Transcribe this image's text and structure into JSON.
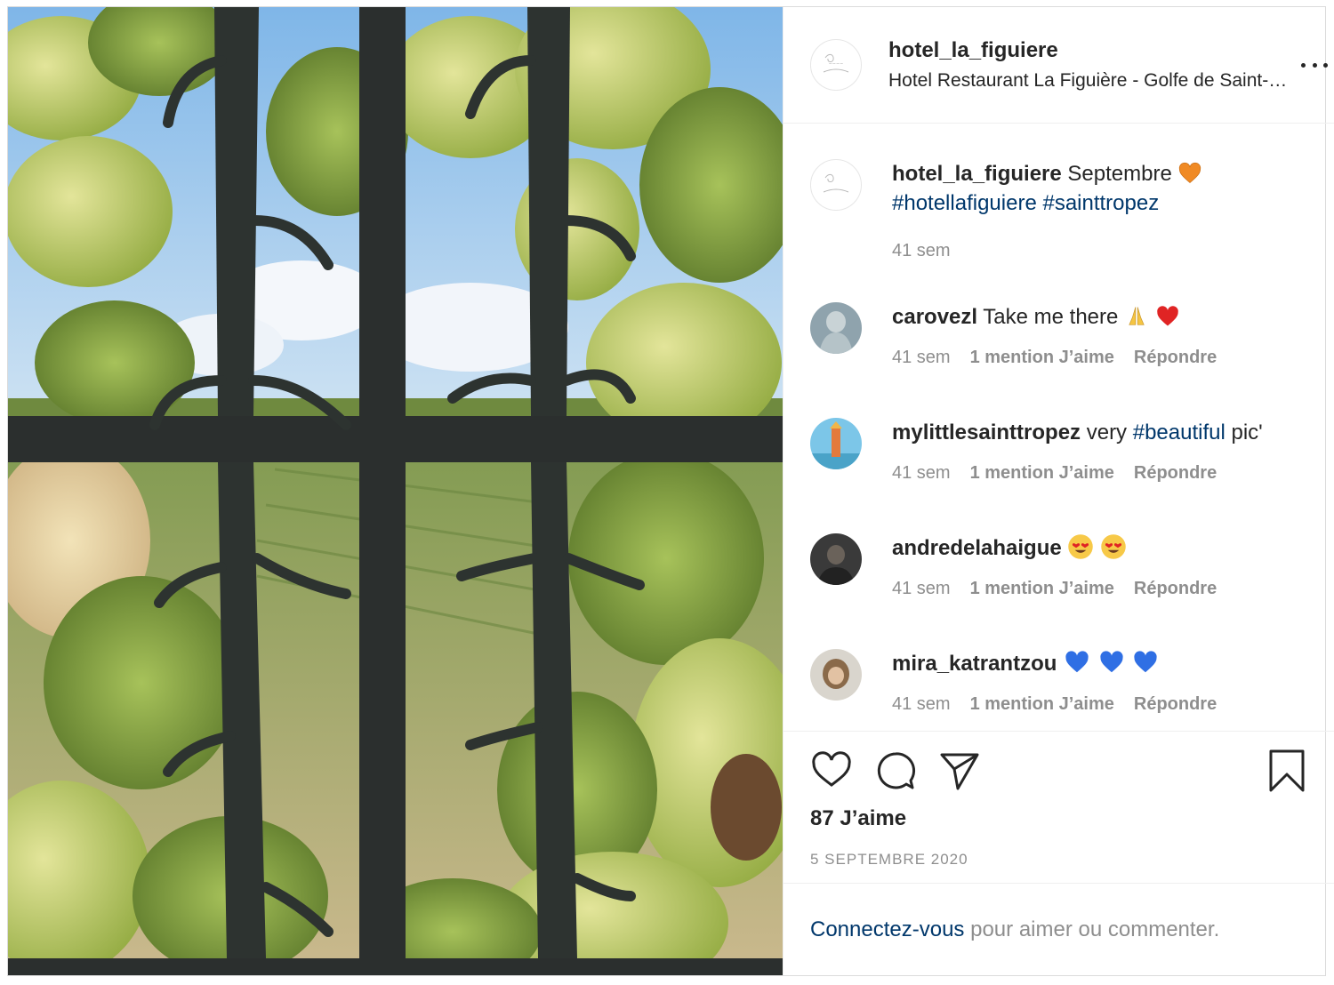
{
  "post": {
    "username": "hotel_la_figuiere",
    "location": "Hotel Restaurant La Figuière - Golfe de Saint-Tropez",
    "image_alt": "Vine leaves around a wrought iron window grille overlooking a vineyard"
  },
  "caption": {
    "username": "hotel_la_figuiere",
    "text": "Septembre",
    "emoji": "orange-heart",
    "hashtags": [
      "#hotellafiguiere",
      "#sainttropez"
    ],
    "time": "41 sem"
  },
  "comments": [
    {
      "username": "carovezl",
      "text": "Take me there",
      "emojis": [
        "folded-hands",
        "red-heart"
      ],
      "time": "41 sem",
      "likes": "1 mention J’aime",
      "reply": "Répondre"
    },
    {
      "username": "mylittlesainttropez",
      "text_before": "very",
      "hashtag": "#beautiful",
      "text_after": "pic'",
      "time": "41 sem",
      "likes": "1 mention J’aime",
      "reply": "Répondre"
    },
    {
      "username": "andredelahaigue",
      "emojis": [
        "heart-eyes",
        "heart-eyes"
      ],
      "time": "41 sem",
      "likes": "1 mention J’aime",
      "reply": "Répondre"
    },
    {
      "username": "mira_katrantzou",
      "emojis": [
        "blue-heart",
        "blue-heart",
        "blue-heart"
      ],
      "time": "41 sem",
      "likes": "1 mention J’aime",
      "reply": "Répondre"
    }
  ],
  "actions": {
    "like_icon": "heart-outline-icon",
    "comment_icon": "comment-bubble-icon",
    "share_icon": "paper-plane-icon",
    "save_icon": "bookmark-icon",
    "likes_count": "87 J’aime",
    "date": "5 SEPTEMBRE 2020"
  },
  "login": {
    "link": "Connectez-vous",
    "text": "pour aimer ou commenter."
  },
  "colors": {
    "text": "#262626",
    "muted": "#8e8e8e",
    "link": "#00376b",
    "border": "#dbdbdb"
  }
}
